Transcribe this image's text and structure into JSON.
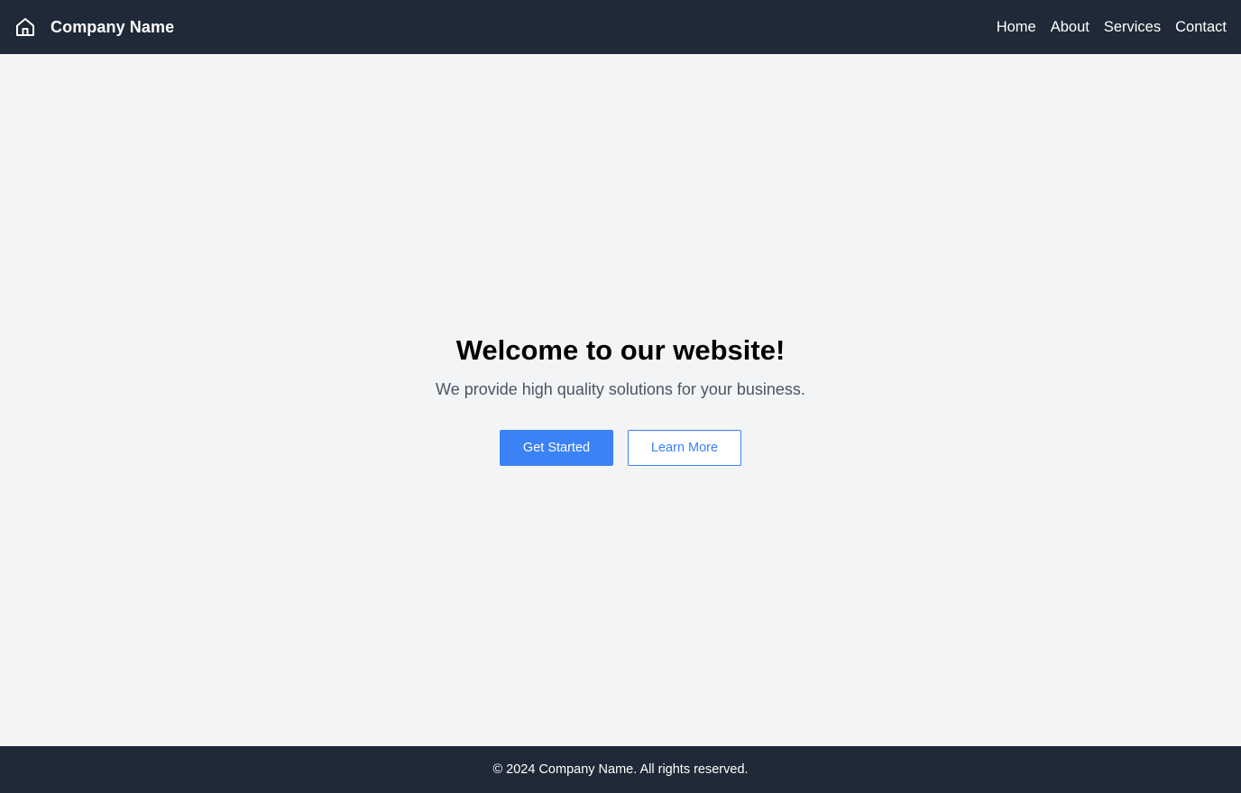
{
  "header": {
    "brand_icon": "home-icon",
    "brand_name": "Company Name",
    "nav": [
      {
        "label": "Home"
      },
      {
        "label": "About"
      },
      {
        "label": "Services"
      },
      {
        "label": "Contact"
      }
    ]
  },
  "hero": {
    "title": "Welcome to our website!",
    "subtitle": "We provide high quality solutions for your business.",
    "primary_button": "Get Started",
    "secondary_button": "Learn More"
  },
  "footer": {
    "text": "© 2024 Company Name. All rights reserved."
  },
  "colors": {
    "header_bg": "#1f2937",
    "page_bg": "#f3f4f6",
    "accent": "#3b82f6",
    "subtitle": "#4b5563"
  }
}
